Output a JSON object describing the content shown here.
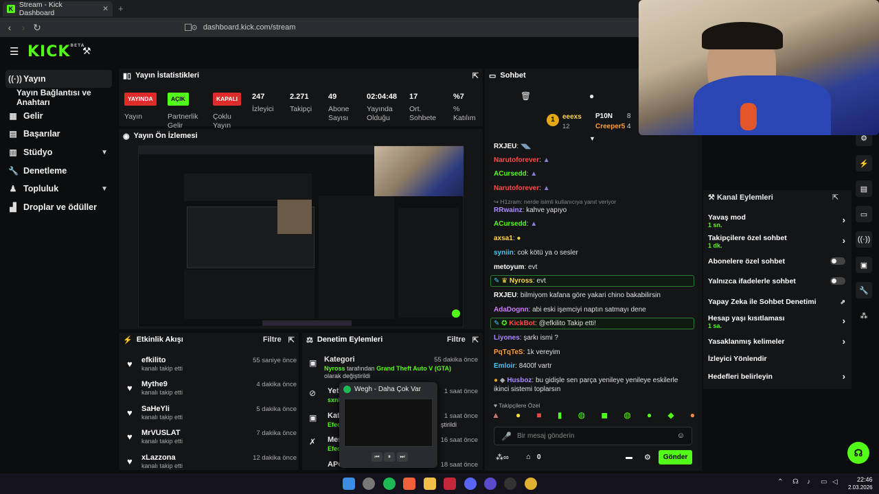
{
  "browser": {
    "tab_title": "Stream - Kick Dashboard",
    "url": "dashboard.kick.com/stream"
  },
  "header": {
    "logo": "KICK",
    "beta": "BETA"
  },
  "sidebar": {
    "items": [
      {
        "label": "Yayın",
        "icon": "broadcast-icon"
      },
      {
        "label": "Yayın Bağlantısı ve Anahtarı",
        "icon": ""
      },
      {
        "label": "Gelir",
        "icon": "revenue-icon"
      },
      {
        "label": "Başarılar",
        "icon": "achievements-icon"
      },
      {
        "label": "Stüdyo",
        "icon": "studio-icon"
      },
      {
        "label": "Denetleme",
        "icon": "moderation-icon"
      },
      {
        "label": "Topluluk",
        "icon": "community-icon"
      },
      {
        "label": "Droplar ve ödüller",
        "icon": "drops-icon"
      }
    ]
  },
  "stats": {
    "title": "Yayın İstatistikleri",
    "status_badge": "YAYINDA",
    "status_label": "Yayın",
    "partner_badge": "AÇIK",
    "partner_label": "Partnerlik Gelir",
    "multi_badge": "KAPALI",
    "multi_label": "Çoklu Yayın",
    "viewers": "247",
    "viewers_label": "İzleyici",
    "followers": "2.271",
    "followers_label": "Takipçi",
    "subs": "49",
    "subs_label": "Abone Sayısı",
    "uptime": "02:04:48",
    "uptime_label": "Yayında Olduğu",
    "avg_chat": "17",
    "avg_chat_label": "Ort. Sohbete",
    "percent": "%7",
    "percent_label": "% Katılım"
  },
  "preview": {
    "title": "Yayın Ön İzlemesi"
  },
  "activity": {
    "title": "Etkinlik Akışı",
    "filter": "Filtre",
    "items": [
      {
        "name": "efkilito",
        "sub": "kanalı takip etti",
        "time": "55 saniye önce"
      },
      {
        "name": "Mythe9",
        "sub": "kanalı takip etti",
        "time": "4 dakika önce"
      },
      {
        "name": "SaHeYli",
        "sub": "kanalı takip etti",
        "time": "5 dakika önce"
      },
      {
        "name": "MrVUSLAT",
        "sub": "kanalı takip etti",
        "time": "7 dakika önce"
      },
      {
        "name": "xLazzona",
        "sub": "kanalı takip etti",
        "time": "12 dakika önce"
      }
    ]
  },
  "moderation": {
    "title": "Denetim Eylemleri",
    "filter": "Filtre",
    "items": [
      {
        "title": "Kategori",
        "user": "Nyross",
        "text": " tarafından ",
        "value": "Grand Theft Auto V (GTA)",
        "text2": " olarak değiştirildi",
        "time": "55 dakika önce"
      },
      {
        "title": "Yetişk",
        "user": "sxnDe",
        "time": "1 saat önce"
      },
      {
        "title": "Kateg",
        "user": "Efeovi",
        "text2": "ştirildi",
        "time": "1 saat önce"
      },
      {
        "title": "Mesa",
        "user": "Efeovi",
        "time": "16 saat önce"
      },
      {
        "title": "APOY",
        "time": "18 saat önce"
      }
    ]
  },
  "media_popup": {
    "title": "Wegh - Daha Çok Var"
  },
  "chat": {
    "title": "Sohbet",
    "leader1": "eeexs",
    "leader1_level": "12",
    "leader2": "P10N",
    "leader2_count": "8",
    "leader3": "Creeper5",
    "leader3_count": "4",
    "reply_hint": "H1zram: nerde isimli kullanıcıya yanıt veriyor",
    "messages": [
      {
        "user": "RXJEU",
        "text": "",
        "color": "#ffffff"
      },
      {
        "user": "Narutoforever",
        "text": "",
        "color": "#ff4a4a"
      },
      {
        "user": "ACursedd",
        "text": "",
        "color": "#53fc18"
      },
      {
        "user": "Narutoforever",
        "text": "",
        "color": "#ff4a4a"
      },
      {
        "user": "RRwainz",
        "text": "kahve yapıyo",
        "color": "#a98bff"
      },
      {
        "user": "ACursedd",
        "text": "",
        "color": "#53fc18"
      },
      {
        "user": "axsa1",
        "text": "",
        "color": "#ffd54a"
      },
      {
        "user": "syniin",
        "text": "cok kötü ya o sesler",
        "color": "#4fc3f7"
      },
      {
        "user": "metoyum",
        "text": "evt",
        "color": "#ffffff"
      },
      {
        "user": "Nyross",
        "text": "evt",
        "color": "#ffd54a"
      },
      {
        "user": "RXJEU",
        "text": "bilmiyom kafana göre yakari chino bakabilirsin",
        "color": "#ffffff"
      },
      {
        "user": "AdaDognn",
        "text": "abi eski işemciyi naptın satmayı dene",
        "color": "#d07cff"
      },
      {
        "user": "KickBot",
        "text": "@efkilito Takip etti!",
        "color": "#ff4a4a"
      },
      {
        "user": "Liyones",
        "text": "şarkı ismi ?",
        "color": "#a98bff"
      },
      {
        "user": "PqTqTeS",
        "text": "1k vereyim",
        "color": "#ff9e40"
      },
      {
        "user": "Emloir",
        "text": "8400f vartr",
        "color": "#4fc3f7"
      },
      {
        "user": "Husboz",
        "text": "bu gidişle sen parça yenileye yenileye eskilerle ikinci sistemi toplarsın",
        "color": "#a98bff"
      }
    ],
    "follower_only": "Takipçilere Özel",
    "input_placeholder": "Bir mesaj gönderin",
    "points": "0",
    "send": "Gönder"
  },
  "channel_actions": {
    "title": "Kanal Eylemleri",
    "items": [
      {
        "label": "Yavaş mod",
        "sub": "1 sn.",
        "type": "arrow"
      },
      {
        "label": "Takipçilere özel sohbet",
        "sub": "1 dk.",
        "type": "arrow"
      },
      {
        "label": "Abonelere özel sohbet",
        "sub": "",
        "type": "toggle"
      },
      {
        "label": "Yalnızca ifadelerle sohbet",
        "sub": "",
        "type": "toggle"
      },
      {
        "label": "Yapay Zeka ile Sohbet Denetimi",
        "sub": "",
        "type": "external"
      },
      {
        "label": "Hesap yaşı kısıtlaması",
        "sub": "1 sa.",
        "type": "arrow"
      },
      {
        "label": "Yasaklanmış kelimeler",
        "sub": "",
        "type": "arrow"
      },
      {
        "label": "İzleyici Yönlendir",
        "sub": "",
        "type": "none"
      },
      {
        "label": "Hedefleri belirleyin",
        "sub": "",
        "type": "arrow"
      }
    ]
  },
  "taskbar": {
    "time": "22:46",
    "date": "2.03.2026"
  },
  "colors": {
    "accent": "#53fc18",
    "live": "#e02b2b",
    "panel": "#141517",
    "bg": "#0c0d0e"
  }
}
